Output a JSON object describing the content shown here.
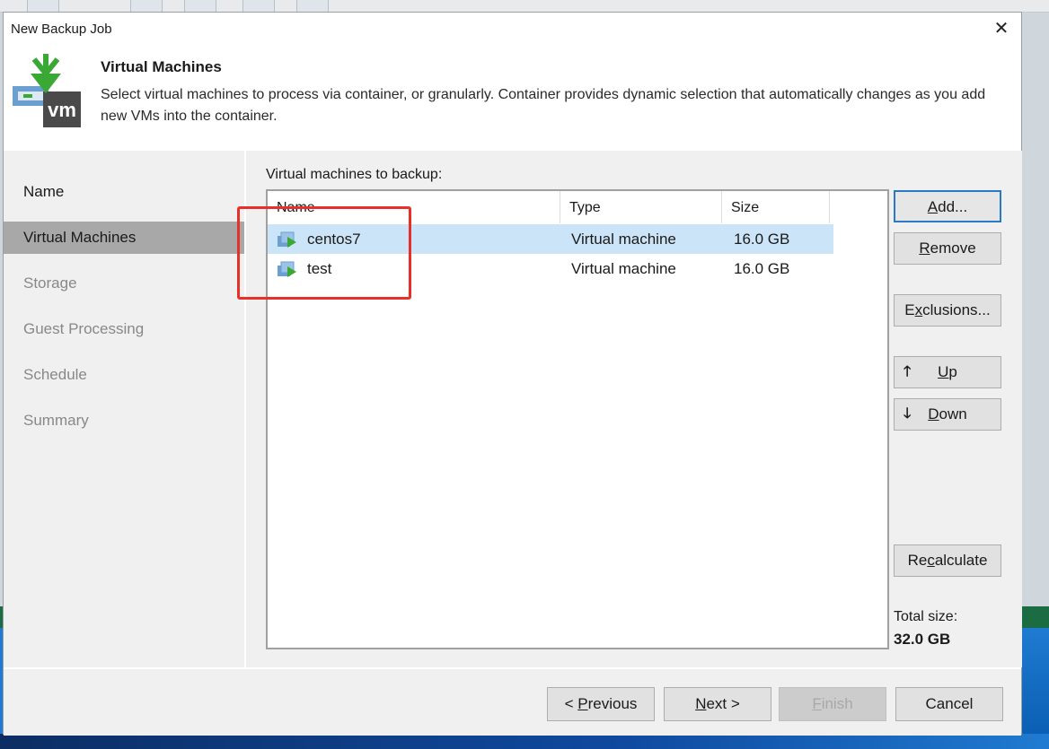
{
  "dialog": {
    "title": "New Backup Job",
    "close_glyph": "✕"
  },
  "header": {
    "icon": "vm-backup-icon",
    "icon_text": "vm",
    "title": "Virtual Machines",
    "description": "Select virtual machines to process via container, or granularly. Container provides dynamic selection that automatically changes as you add new VMs into the container."
  },
  "nav": {
    "items": [
      {
        "label": "Name",
        "state": "done"
      },
      {
        "label": "Virtual Machines",
        "state": "active"
      },
      {
        "label": "Storage",
        "state": "pending"
      },
      {
        "label": "Guest Processing",
        "state": "pending"
      },
      {
        "label": "Schedule",
        "state": "pending"
      },
      {
        "label": "Summary",
        "state": "pending"
      }
    ]
  },
  "vm_list": {
    "label": "Virtual machines to backup:",
    "columns": [
      "Name",
      "Type",
      "Size"
    ],
    "rows": [
      {
        "name": "centos7",
        "type": "Virtual machine",
        "size": "16.0 GB",
        "selected": true
      },
      {
        "name": "test",
        "type": "Virtual machine",
        "size": "16.0 GB",
        "selected": false
      }
    ]
  },
  "side_buttons": {
    "add": {
      "pre": "",
      "key": "A",
      "post": "dd..."
    },
    "remove": {
      "pre": "",
      "key": "R",
      "post": "emove"
    },
    "exclusions": {
      "pre": "E",
      "key": "x",
      "post": "clusions..."
    },
    "up": {
      "pre": "",
      "key": "U",
      "post": "p",
      "glyph": "🡑"
    },
    "down": {
      "pre": "",
      "key": "D",
      "post": "own",
      "glyph": "🡓"
    },
    "recalculate": {
      "pre": "Re",
      "key": "c",
      "post": "alculate"
    }
  },
  "total": {
    "label": "Total size:",
    "value": "32.0 GB"
  },
  "footer": {
    "previous": {
      "pre": "< ",
      "key": "P",
      "post": "revious"
    },
    "next": {
      "pre": "",
      "key": "N",
      "post": "ext >"
    },
    "finish": {
      "pre": "",
      "key": "F",
      "post": "inish"
    },
    "cancel": "Cancel"
  },
  "colors": {
    "selected_row": "#cce4f7",
    "active_nav": "#a8a8a8",
    "annotation_box": "#e8302a",
    "vm_icon_green": "#3aa835",
    "vm_icon_blue": "#6a9fd0"
  }
}
